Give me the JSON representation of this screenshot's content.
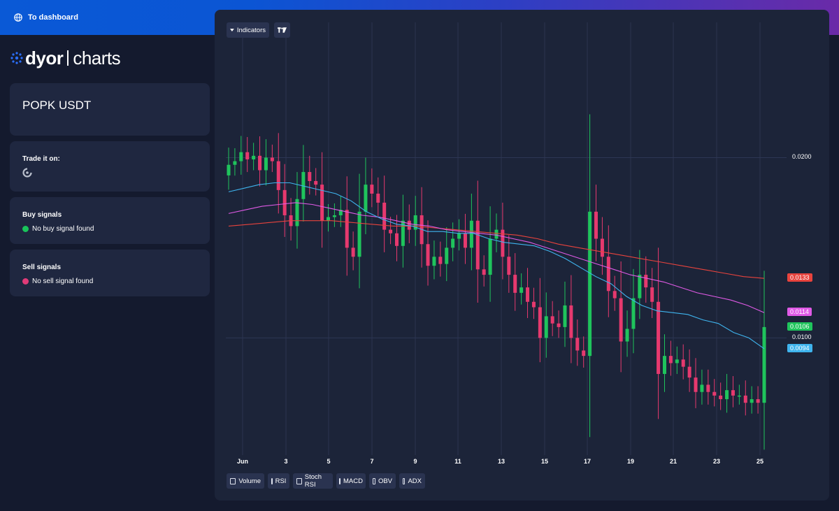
{
  "header": {
    "dashboard_link": "To dashboard"
  },
  "logo": {
    "brand": "dyor",
    "product": "charts"
  },
  "pair": {
    "title": "POPK USDT"
  },
  "trade": {
    "title": "Trade it on:"
  },
  "buy_signals": {
    "title": "Buy signals",
    "status": "No buy signal found",
    "status_color": "#19c45a"
  },
  "sell_signals": {
    "title": "Sell signals",
    "status": "No sell signal found",
    "status_color": "#e03b78"
  },
  "toolbar": {
    "indicators_label": "Indicators",
    "tv_label": "TV"
  },
  "bottom_toggles": [
    "Volume",
    "RSI",
    "Stoch RSI",
    "MACD",
    "OBV",
    "ADX"
  ],
  "colors": {
    "up": "#1fc45c",
    "down": "#e6396e",
    "ema_short": "#3fb4ee",
    "ema_mid": "#e05ae6",
    "ema_long": "#e8433d"
  },
  "chart_data": {
    "type": "candlestick",
    "y_axis": {
      "labels": [
        "0.0200",
        "0.0100"
      ],
      "values": [
        0.02,
        0.01
      ],
      "range": [
        0.0035,
        0.0275
      ]
    },
    "x_axis": {
      "labels": [
        "Jun",
        "3",
        "5",
        "7",
        "9",
        "11",
        "13",
        "15",
        "17",
        "19",
        "21",
        "23",
        "25"
      ]
    },
    "price_tags": [
      {
        "value": "0.0133",
        "series": "ema_long"
      },
      {
        "value": "0.0114",
        "series": "ema_mid"
      },
      {
        "value": "0.0106",
        "series": "last_price"
      },
      {
        "value": "0.0094",
        "series": "ema_short"
      }
    ],
    "grid": true,
    "close": [
      0.0196,
      0.0198,
      0.0203,
      0.0199,
      0.0201,
      0.0193,
      0.02,
      0.0198,
      0.0182,
      0.0168,
      0.0162,
      0.0177,
      0.0192,
      0.0187,
      0.0185,
      0.0165,
      0.0167,
      0.0168,
      0.0171,
      0.015,
      0.0145,
      0.017,
      0.0185,
      0.018,
      0.0175,
      0.016,
      0.0158,
      0.0151,
      0.0165,
      0.016,
      0.0168,
      0.0152,
      0.014,
      0.0145,
      0.0141,
      0.015,
      0.0155,
      0.0158,
      0.015,
      0.0165,
      0.0138,
      0.0135,
      0.0155,
      0.016,
      0.0145,
      0.0135,
      0.0125,
      0.0128,
      0.012,
      0.0117,
      0.01,
      0.0112,
      0.0108,
      0.0106,
      0.0118,
      0.01,
      0.0093,
      0.009,
      0.017,
      0.0155,
      0.0145,
      0.0126,
      0.0122,
      0.0098,
      0.0105,
      0.0122,
      0.0135,
      0.0128,
      0.012,
      0.008,
      0.009,
      0.0086,
      0.0088,
      0.0084,
      0.0078,
      0.007,
      0.0074,
      0.007,
      0.0068,
      0.0066,
      0.0071,
      0.0068,
      0.0068,
      0.0064,
      0.0066,
      0.0064,
      0.0106
    ],
    "ema": {
      "ema_short": [
        0.0181,
        0.0183,
        0.0185,
        0.0186,
        0.0186,
        0.0184,
        0.0182,
        0.018,
        0.0176,
        0.017,
        0.0166,
        0.0163,
        0.0162,
        0.0159,
        0.0159,
        0.0158,
        0.0158,
        0.0155,
        0.0153,
        0.0152,
        0.0151,
        0.0148,
        0.0144,
        0.0139,
        0.0134,
        0.013,
        0.0123,
        0.0118,
        0.0115,
        0.0114,
        0.0113,
        0.011,
        0.0108,
        0.0103,
        0.01,
        0.0094
      ],
      "ema_mid": [
        0.0169,
        0.0171,
        0.0173,
        0.0174,
        0.0175,
        0.0174,
        0.0172,
        0.017,
        0.0168,
        0.0167,
        0.0165,
        0.0163,
        0.0162,
        0.016,
        0.0159,
        0.0158,
        0.0157,
        0.0155,
        0.0153,
        0.015,
        0.0147,
        0.0144,
        0.0141,
        0.0138,
        0.0135,
        0.0133,
        0.0131,
        0.0128,
        0.0125,
        0.0123,
        0.0121,
        0.0118,
        0.0114
      ],
      "ema_long": [
        0.0162,
        0.0163,
        0.0164,
        0.0165,
        0.0165,
        0.0165,
        0.0164,
        0.0163,
        0.0162,
        0.0162,
        0.0161,
        0.016,
        0.0159,
        0.0158,
        0.0157,
        0.0155,
        0.0152,
        0.015,
        0.0148,
        0.0146,
        0.0144,
        0.0142,
        0.014,
        0.0138,
        0.0136,
        0.0134,
        0.0133
      ]
    }
  }
}
